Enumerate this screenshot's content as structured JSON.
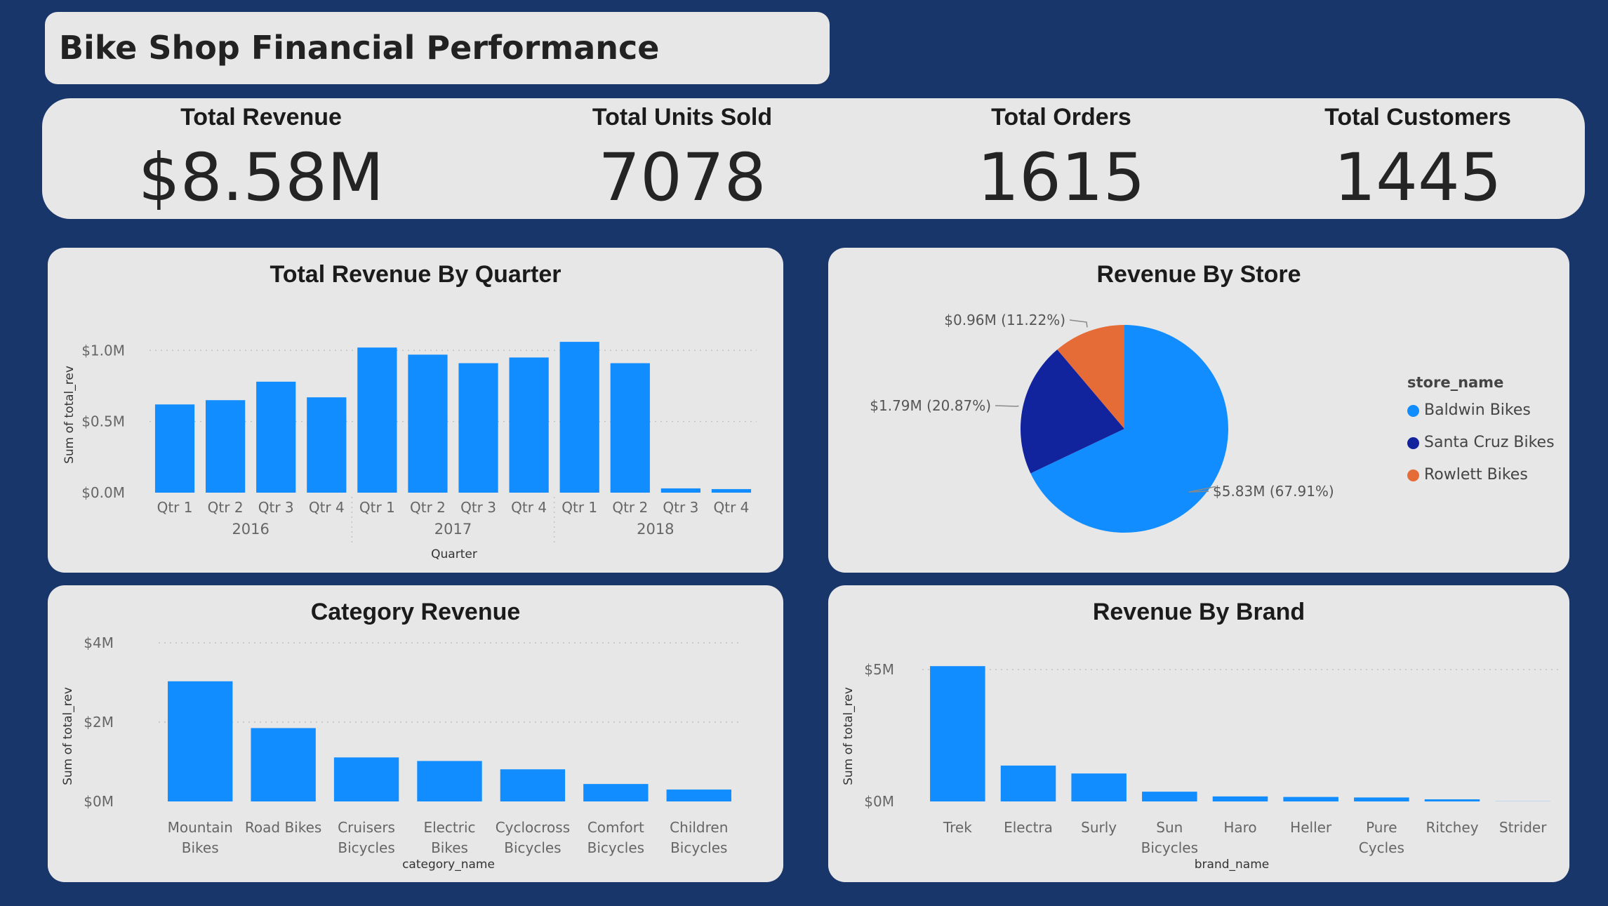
{
  "title": "Bike Shop Financial Performance",
  "kpis": [
    {
      "label": "Total Revenue",
      "value": "$8.58M"
    },
    {
      "label": "Total Units Sold",
      "value": "7078"
    },
    {
      "label": "Total Orders",
      "value": "1615"
    },
    {
      "label": "Total Customers",
      "value": "1445"
    }
  ],
  "colors": {
    "background": "#19366b",
    "panel": "#e7e7e7",
    "bar": "#118dff",
    "dark_blue": "#12239e",
    "orange": "#e66c37"
  },
  "chart_data": [
    {
      "id": "quarter",
      "type": "bar",
      "title": "Total Revenue By Quarter",
      "xlabel": "Quarter",
      "ylabel": "Sum of total_rev",
      "categories": [
        "Qtr 1",
        "Qtr 2",
        "Qtr 3",
        "Qtr 4",
        "Qtr 1",
        "Qtr 2",
        "Qtr 3",
        "Qtr 4",
        "Qtr 1",
        "Qtr 2",
        "Qtr 3",
        "Qtr 4"
      ],
      "groups": [
        {
          "label": "2016",
          "count": 4
        },
        {
          "label": "2017",
          "count": 4
        },
        {
          "label": "2018",
          "count": 4
        }
      ],
      "values": [
        0.62,
        0.65,
        0.78,
        0.67,
        1.02,
        0.97,
        0.91,
        0.95,
        1.06,
        0.91,
        0.03,
        0.025
      ],
      "yticks": [
        {
          "v": 0.0,
          "label": "$0.0M"
        },
        {
          "v": 0.5,
          "label": "$0.5M"
        },
        {
          "v": 1.0,
          "label": "$1.0M"
        }
      ],
      "ylim": [
        0,
        1.1
      ],
      "grid": true
    },
    {
      "id": "store",
      "type": "pie",
      "title": "Revenue By Store",
      "legend_title": "store_name",
      "legend_position": "right",
      "slices": [
        {
          "name": "Baldwin Bikes",
          "value": 5.83,
          "percent": 67.91,
          "label": "$5.83M (67.91%)",
          "color": "#118dff"
        },
        {
          "name": "Santa Cruz Bikes",
          "value": 1.79,
          "percent": 20.87,
          "label": "$1.79M (20.87%)",
          "color": "#12239e"
        },
        {
          "name": "Rowlett Bikes",
          "value": 0.96,
          "percent": 11.22,
          "label": "$0.96M (11.22%)",
          "color": "#e66c37"
        }
      ]
    },
    {
      "id": "category",
      "type": "bar",
      "title": "Category Revenue",
      "xlabel": "category_name",
      "ylabel": "Sum of total_rev",
      "categories": [
        [
          "Mountain",
          "Bikes"
        ],
        [
          "Road Bikes"
        ],
        [
          "Cruisers",
          "Bicycles"
        ],
        [
          "Electric",
          "Bikes"
        ],
        [
          "Cyclocross",
          "Bicycles"
        ],
        [
          "Comfort",
          "Bicycles"
        ],
        [
          "Children",
          "Bicycles"
        ]
      ],
      "values": [
        3.03,
        1.85,
        1.11,
        1.02,
        0.81,
        0.44,
        0.3
      ],
      "yticks": [
        {
          "v": 0,
          "label": "$0M"
        },
        {
          "v": 2,
          "label": "$2M"
        },
        {
          "v": 4,
          "label": "$4M"
        }
      ],
      "ylim": [
        0,
        4
      ],
      "grid": true
    },
    {
      "id": "brand",
      "type": "bar",
      "title": "Revenue By Brand",
      "xlabel": "brand_name",
      "ylabel": "Sum of total_rev",
      "categories": [
        [
          "Trek"
        ],
        [
          "Electra"
        ],
        [
          "Surly"
        ],
        [
          "Sun",
          "Bicycles"
        ],
        [
          "Haro"
        ],
        [
          "Heller"
        ],
        [
          "Pure",
          "Cycles"
        ],
        [
          "Ritchey"
        ],
        [
          "Strider"
        ]
      ],
      "values": [
        5.13,
        1.36,
        1.06,
        0.37,
        0.19,
        0.17,
        0.15,
        0.08,
        0.005
      ],
      "yticks": [
        {
          "v": 0,
          "label": "$0M"
        },
        {
          "v": 5,
          "label": "$5M"
        }
      ],
      "ylim": [
        0,
        6.2
      ],
      "grid": true
    }
  ]
}
